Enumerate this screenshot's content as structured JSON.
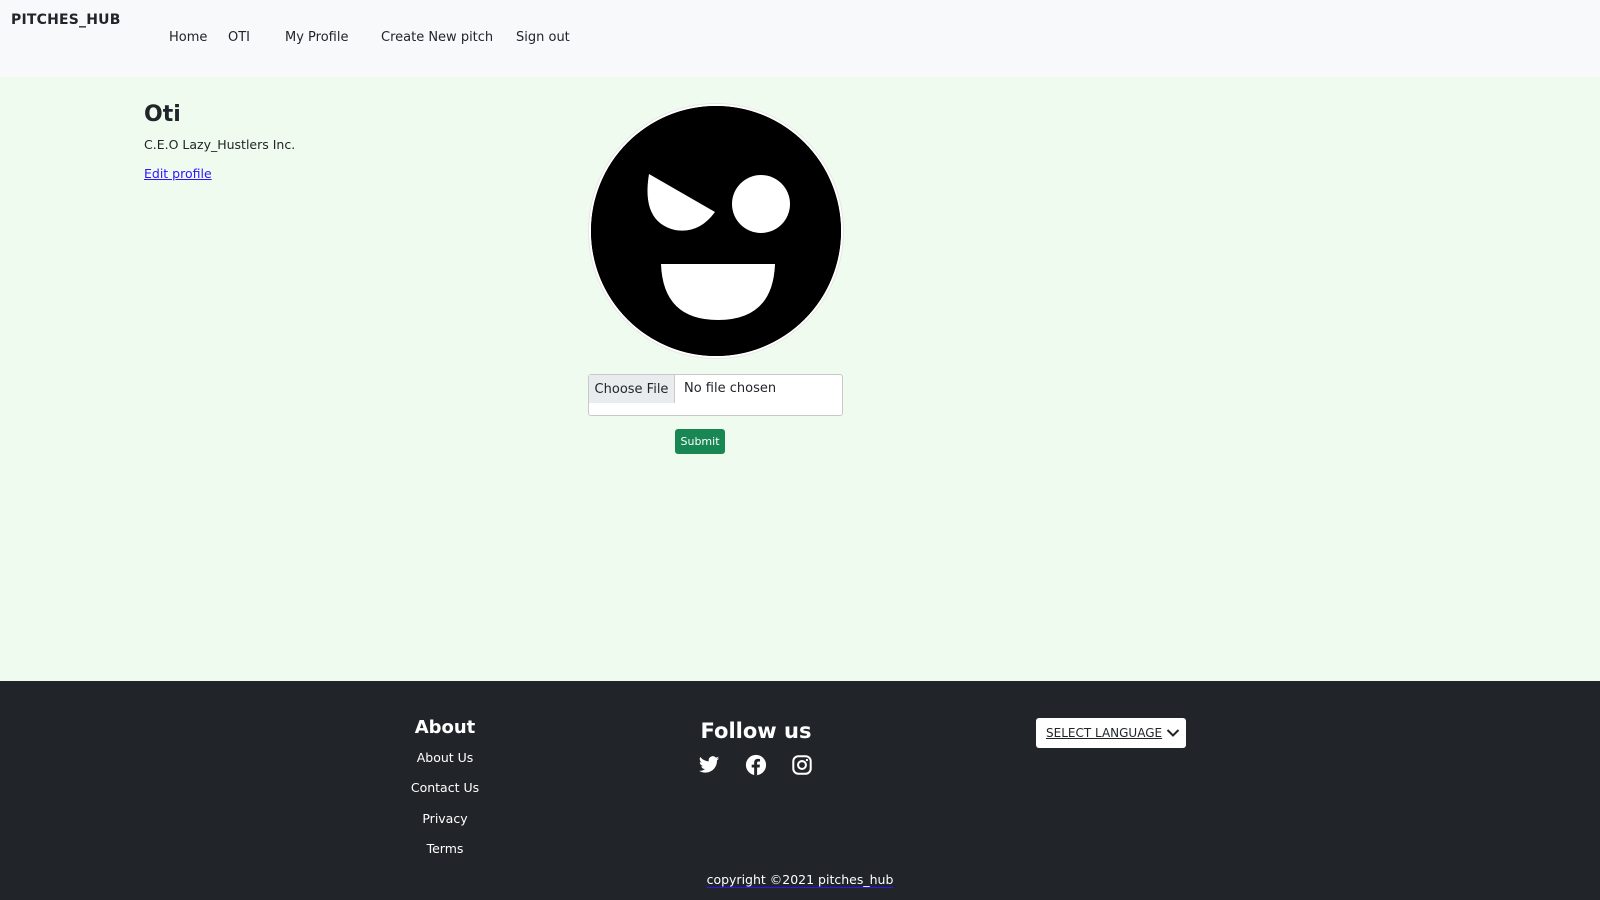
{
  "navbar": {
    "brand": "PITCHES_HUB",
    "links": [
      "Home",
      "OTI",
      "My Profile",
      "Create New pitch",
      "Sign out"
    ]
  },
  "profile": {
    "name": "Oti",
    "bio": "C.E.O Lazy_Hustlers Inc.",
    "edit_link": "Edit profile",
    "avatar_icon": "winking-smiley-avatar"
  },
  "upload": {
    "choose_file": "Choose File",
    "status": "No file chosen",
    "submit": "Submit"
  },
  "footer": {
    "about_title": "About",
    "about_links": [
      "About Us",
      "Contact Us",
      "Privacy",
      "Terms"
    ],
    "follow_title": "Follow us",
    "social_icons": [
      "twitter-icon",
      "facebook-icon",
      "instagram-icon"
    ],
    "language_button": "SELECT LANGUAGE",
    "copyright": "copyright ©2021 pitches_hub"
  },
  "colors": {
    "page_bg": "#f0fbf0",
    "navbar_bg": "#f8f9fa",
    "footer_bg": "#212529",
    "submit_bg": "#198754",
    "link": "#2d14ff"
  }
}
